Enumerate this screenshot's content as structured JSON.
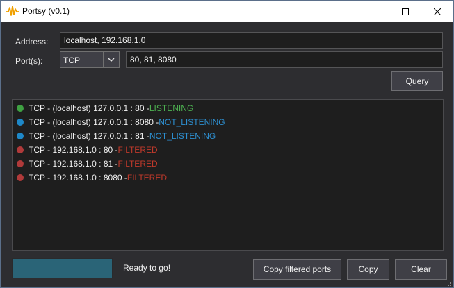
{
  "window": {
    "title": "Portsy (v0.1)",
    "icon": "pulse-waveform-icon"
  },
  "form": {
    "address_label": "Address:",
    "address_value": "localhost, 192.168.1.0",
    "ports_label": "Port(s):",
    "protocol_selected": "TCP",
    "ports_value": "80, 81, 8080",
    "query_label": "Query"
  },
  "results": [
    {
      "prefix": "TCP - (localhost) 127.0.0.1 : 80 - ",
      "state": "LISTENING",
      "color": "#3fa142",
      "state_color": "#4caf50"
    },
    {
      "prefix": "TCP - (localhost) 127.0.0.1 : 8080 - ",
      "state": "NOT_LISTENING",
      "color": "#1e88c8",
      "state_color": "#2d8fd0"
    },
    {
      "prefix": "TCP - (localhost) 127.0.0.1 : 81 - ",
      "state": "NOT_LISTENING",
      "color": "#1e88c8",
      "state_color": "#2d8fd0"
    },
    {
      "prefix": "TCP - 192.168.1.0 : 80 - ",
      "state": "FILTERED",
      "color": "#b03a3a",
      "state_color": "#c0392b"
    },
    {
      "prefix": "TCP - 192.168.1.0 : 81 - ",
      "state": "FILTERED",
      "color": "#b03a3a",
      "state_color": "#c0392b"
    },
    {
      "prefix": "TCP - 192.168.1.0 : 8080 - ",
      "state": "FILTERED",
      "color": "#b03a3a",
      "state_color": "#c0392b"
    }
  ],
  "footer": {
    "progress": 1.0,
    "status": "Ready to go!",
    "copy_filtered_label": "Copy filtered ports",
    "copy_label": "Copy",
    "clear_label": "Clear"
  }
}
